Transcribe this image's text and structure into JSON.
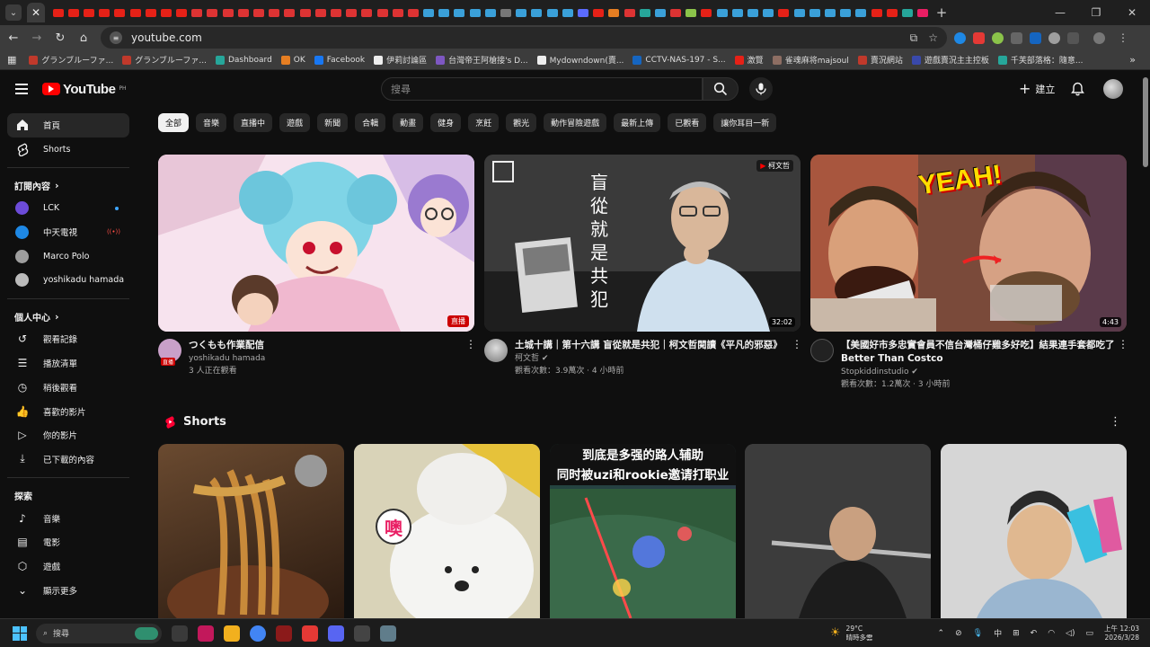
{
  "browser": {
    "url": "youtube.com",
    "tab_colors": [
      "#e62117",
      "#e62117",
      "#e62117",
      "#e62117",
      "#e62117",
      "#e62117",
      "#e62117",
      "#e62117",
      "#e62117",
      "#d33",
      "#d33",
      "#d33",
      "#d33",
      "#d33",
      "#d33",
      "#d33",
      "#d33",
      "#d33",
      "#d33",
      "#d33",
      "#d33",
      "#d33",
      "#d33",
      "#d33",
      "#3aa0d9",
      "#3aa0d9",
      "#3aa0d9",
      "#3aa0d9",
      "#3aa0d9",
      "#777",
      "#3aa0d9",
      "#3aa0d9",
      "#3aa0d9",
      "#3aa0d9",
      "#5b6bff",
      "#e62117",
      "#e67e22",
      "#d33",
      "#26a69a",
      "#3aa0d9",
      "#d33",
      "#8bc34a",
      "#e62117",
      "#3aa0d9",
      "#3aa0d9",
      "#3aa0d9",
      "#3aa0d9",
      "#e62117",
      "#3aa0d9",
      "#3aa0d9",
      "#3aa0d9",
      "#3aa0d9",
      "#3aa0d9",
      "#e62117",
      "#e62117",
      "#26a69a",
      "#e91e63"
    ],
    "bookmarks": [
      {
        "label": "グランブルーファ...",
        "color": "#c0392b"
      },
      {
        "label": "グランブルーファ...",
        "color": "#c0392b"
      },
      {
        "label": "Dashboard",
        "color": "#26a69a"
      },
      {
        "label": "OK",
        "color": "#e67e22"
      },
      {
        "label": "Facebook",
        "color": "#1877f2"
      },
      {
        "label": "伊莉討論區",
        "color": "#eee"
      },
      {
        "label": "台灣帝王阿槍接's D...",
        "color": "#7e57c2"
      },
      {
        "label": "Mydowndown(賣...",
        "color": "#eee"
      },
      {
        "label": "CCTV-NAS-197 - S...",
        "color": "#1565c0"
      },
      {
        "label": "激覽",
        "color": "#e62117"
      },
      {
        "label": "雀魂麻将majsoul",
        "color": "#8d6e63"
      },
      {
        "label": "賣況網站",
        "color": "#c0392b"
      },
      {
        "label": "遊戲賣況主主控板",
        "color": "#3949ab"
      },
      {
        "label": "千芙部落格：隨意...",
        "color": "#26a69a"
      }
    ]
  },
  "header": {
    "search_placeholder": "搜尋",
    "create_label": "建立",
    "region": "PH"
  },
  "sidebar": {
    "main": [
      {
        "label": "首頁",
        "icon": "home-icon"
      },
      {
        "label": "Shorts",
        "icon": "shorts-icon"
      }
    ],
    "subs_title": "訂閱內容",
    "subs": [
      {
        "label": "LCK",
        "color": "#6c4bd8",
        "badge": "dot"
      },
      {
        "label": "中天電視",
        "color": "#1e88e5",
        "badge": "live"
      },
      {
        "label": "Marco Polo",
        "color": "#9e9e9e",
        "badge": ""
      },
      {
        "label": "yoshikadu hamada",
        "color": "#bbb",
        "badge": ""
      }
    ],
    "you_title": "個人中心",
    "you": [
      {
        "label": "觀看記錄",
        "icon": "history-icon"
      },
      {
        "label": "播放清單",
        "icon": "playlist-icon"
      },
      {
        "label": "稍後觀看",
        "icon": "watch-later-icon"
      },
      {
        "label": "喜歡的影片",
        "icon": "like-icon"
      },
      {
        "label": "你的影片",
        "icon": "your-videos-icon"
      },
      {
        "label": "已下載的內容",
        "icon": "download-icon"
      }
    ],
    "explore_title": "探索",
    "explore": [
      {
        "label": "音樂",
        "icon": "music-icon"
      },
      {
        "label": "電影",
        "icon": "movie-icon"
      },
      {
        "label": "遊戲",
        "icon": "gaming-icon"
      },
      {
        "label": "顯示更多",
        "icon": "chevron-down-icon"
      }
    ]
  },
  "chips": [
    "全部",
    "音樂",
    "直播中",
    "遊戲",
    "新聞",
    "合輯",
    "動畫",
    "健身",
    "烹飪",
    "觀光",
    "動作冒險遊戲",
    "最新上傳",
    "已觀看",
    "讓你耳目一新"
  ],
  "videos": [
    {
      "title": "つくもも作業配信",
      "channel": "yoshikadu hamada",
      "stats": "3 人正在觀看",
      "badge": "直播",
      "badge_type": "live",
      "verified": false,
      "thumb": "anime",
      "avatar_color": "#c9a0c9"
    },
    {
      "title": "土城十講｜第十六講 盲從就是共犯｜柯文哲閱讀《平凡的邪惡》",
      "channel": "柯文哲",
      "stats": "觀看次數：3.9萬次 · 4 小時前",
      "badge": "32:02",
      "badge_type": "duration",
      "verified": true,
      "thumb": "ko",
      "channel_tag": "柯文哲",
      "avatar_color": "#999"
    },
    {
      "title": "【美國好市多忠實會員不信台灣桶仔雞多好吃】結果連手套都吃了 Better Than Costco",
      "channel": "Stopkiddinstudio",
      "stats": "觀看次數：1.2萬次 · 3 小時前",
      "badge": "4:43",
      "badge_type": "duration",
      "verified": true,
      "thumb": "yeah",
      "avatar_color": "#222"
    }
  ],
  "thumb_text": {
    "ko": "盲從就是共犯",
    "yeah": "YEAH!"
  },
  "shorts_title": "Shorts",
  "shorts": [
    {
      "caption": "",
      "color_a": "#8a5a2a",
      "color_b": "#3a2a1a"
    },
    {
      "caption": "",
      "color_a": "#eee9d8",
      "color_b": "#b8a060",
      "sticker": "噢"
    },
    {
      "caption": "到底是多强的路人辅助\n同时被uzi和rookie邀请打职业",
      "color_a": "#1f4a3a",
      "color_b": "#3a2a5a"
    },
    {
      "caption": "",
      "color_a": "#555",
      "color_b": "#222"
    },
    {
      "caption": "",
      "color_a": "#dcdcdc",
      "color_b": "#5a6a7a"
    }
  ],
  "taskbar": {
    "search_placeholder": "搜尋",
    "apps": [
      "#3a3a3a",
      "#c2185b",
      "#f2b01e",
      "#4285f4",
      "#8b1a1a",
      "#e53935",
      "#5865f2",
      "#444",
      "#607d8b"
    ],
    "weather_temp": "29°C",
    "weather_desc": "晴時多雲",
    "ime": "中",
    "time": "上午 12:03",
    "date": "2026/3/28"
  }
}
